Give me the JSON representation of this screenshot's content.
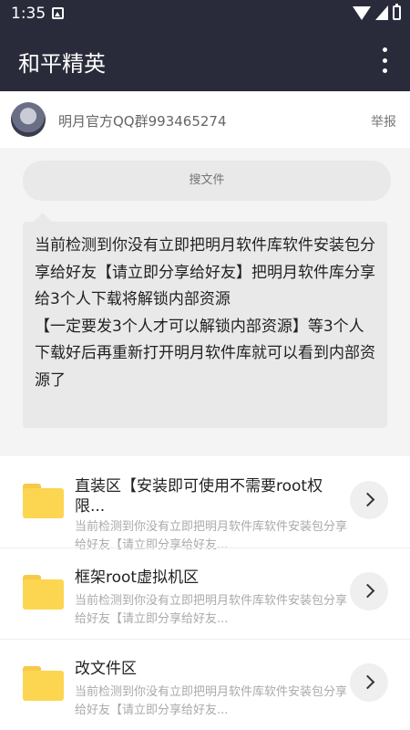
{
  "status_bar": {
    "time": "1:35"
  },
  "app_bar": {
    "title": "和平精英"
  },
  "poster": {
    "name": "明月官方QQ群993465274",
    "report_label": "举报"
  },
  "search": {
    "placeholder": "搜文件"
  },
  "message": {
    "text": "当前检测到你没有立即把明月软件库软件安装包分享给好友【请立即分享给好友】把明月软件库分享给3个人下载将解锁内部资源\n【一定要发3个人才可以解锁内部资源】等3个人下载好后再重新打开明月软件库就可以看到内部资源了"
  },
  "folders": [
    {
      "title": "直装区【安装即可使用不需要root权限...",
      "desc": "当前检测到你没有立即把明月软件库软件安装包分享给好友【请立即分享给好友..."
    },
    {
      "title": "框架root虚拟机区",
      "desc": "当前检测到你没有立即把明月软件库软件安装包分享给好友【请立即分享给好友..."
    },
    {
      "title": "改文件区",
      "desc": "当前检测到你没有立即把明月软件库软件安装包分享给好友【请立即分享给好友..."
    }
  ]
}
